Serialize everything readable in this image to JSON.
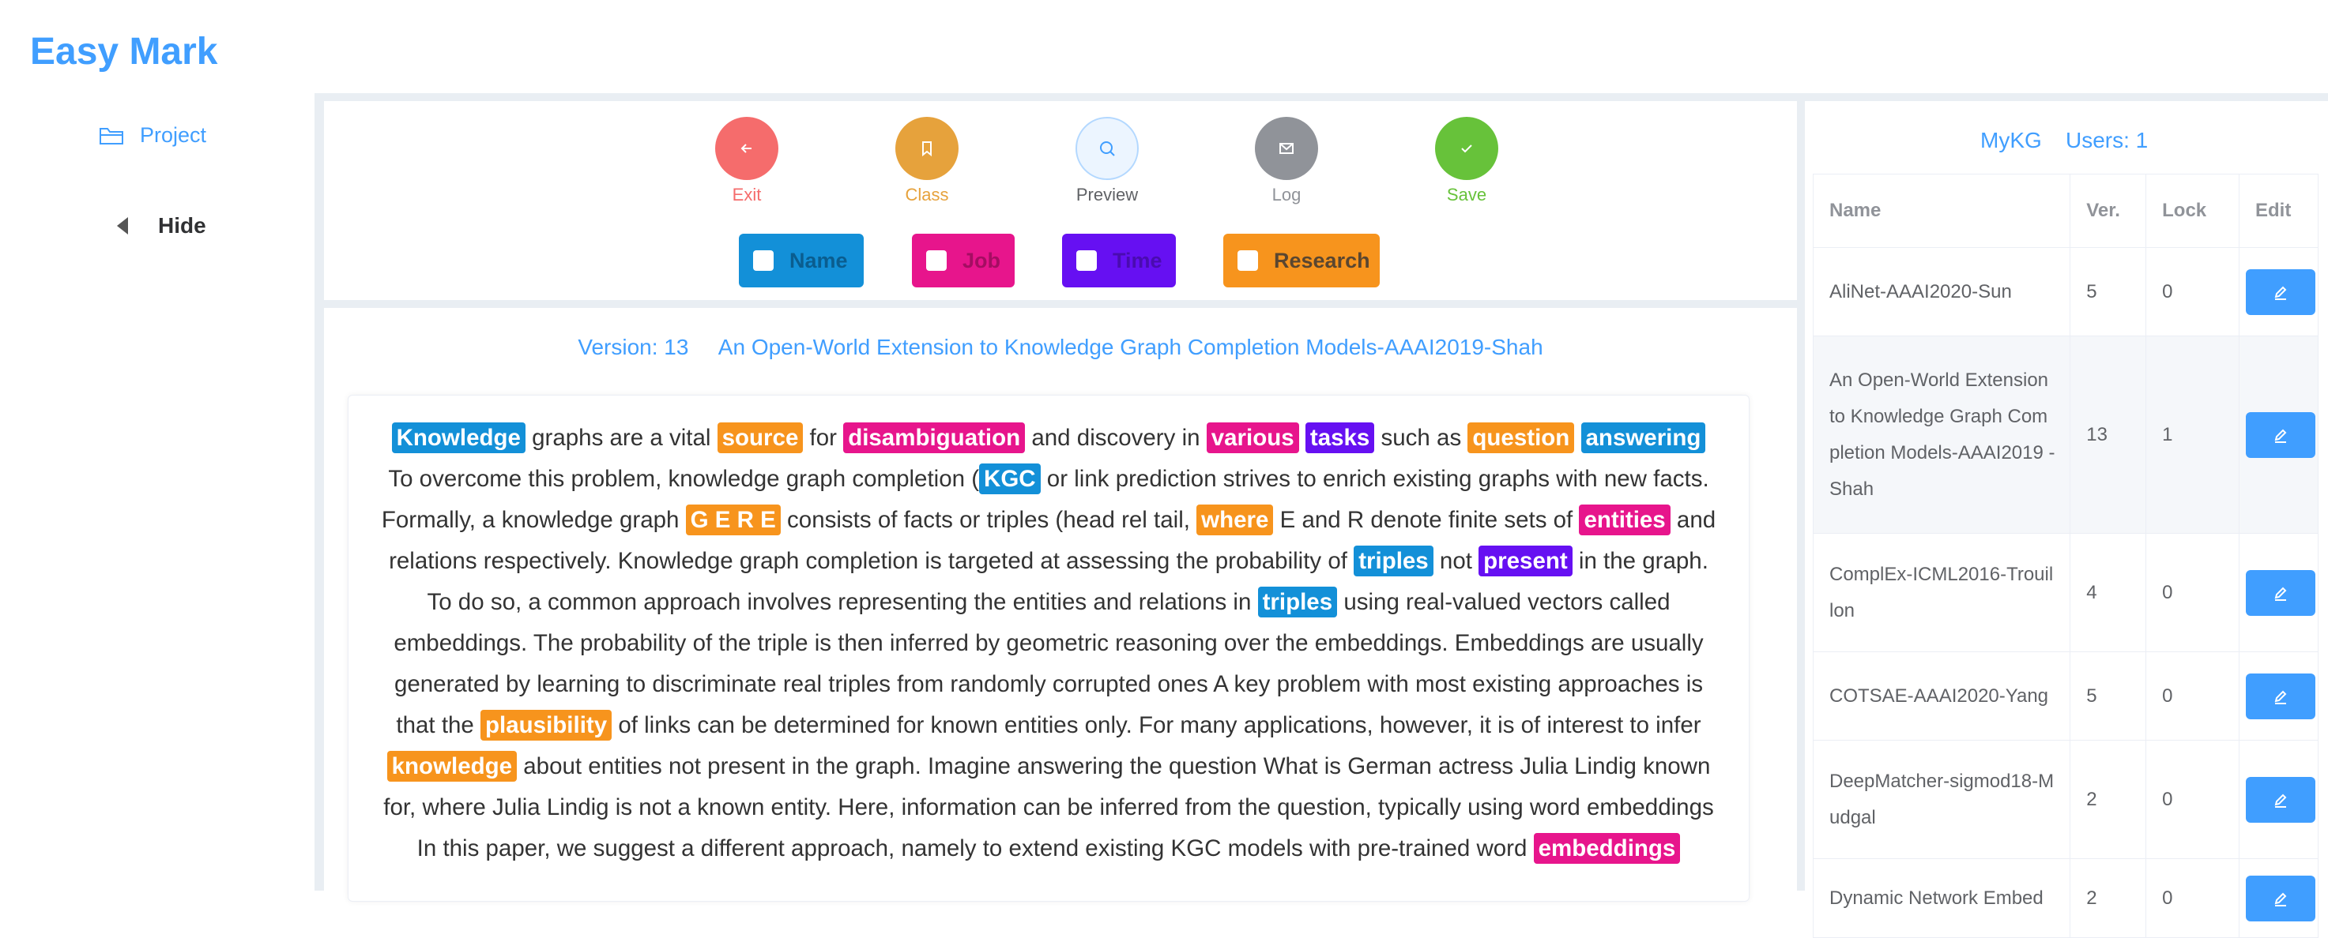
{
  "app": {
    "title": "Easy Mark"
  },
  "sidebar": {
    "project_label": "Project",
    "hide_label": "Hide"
  },
  "toolbar": {
    "exit": {
      "label": "Exit",
      "color": "#f56c6c",
      "icon": "arrow-left-icon"
    },
    "class": {
      "label": "Class",
      "color": "#e6a23c",
      "icon": "bookmark-icon"
    },
    "preview": {
      "label": "Preview",
      "color": "#ecf5ff",
      "icon": "search-icon"
    },
    "log": {
      "label": "Log",
      "color": "#909399",
      "icon": "envelope-icon"
    },
    "save": {
      "label": "Save",
      "color": "#67c23a",
      "icon": "check-icon"
    }
  },
  "tags": [
    {
      "label": "Name",
      "color": "#1390d8"
    },
    {
      "label": "Job",
      "color": "#e7158c"
    },
    {
      "label": "Time",
      "color": "#6610f2"
    },
    {
      "label": "Research",
      "color": "#f7941d"
    }
  ],
  "document": {
    "version": "Version: 13",
    "title": "An Open-World Extension to Knowledge Graph Completion Models-AAAI2019-Shah",
    "segments": [
      [
        "Knowledge",
        "b"
      ],
      [
        " graphs are a vital ",
        ""
      ],
      [
        "source",
        "o"
      ],
      [
        " for ",
        ""
      ],
      [
        "disambiguation",
        "p"
      ],
      [
        " and discovery in ",
        ""
      ],
      [
        "various",
        "p"
      ],
      [
        " ",
        ""
      ],
      [
        "tasks",
        "v"
      ],
      [
        " such as ",
        ""
      ],
      [
        "question",
        "o"
      ],
      [
        " ",
        ""
      ],
      [
        "answering",
        "b"
      ],
      [
        " To overcome this problem, knowledge graph completion (",
        ""
      ],
      [
        "KGC",
        "b"
      ],
      [
        " or link prediction strives to enrich existing graphs with new facts. Formally, a knowledge graph ",
        ""
      ],
      [
        "G E R E",
        "o"
      ],
      [
        " consists of facts or triples (head rel tail, ",
        ""
      ],
      [
        "where",
        "o"
      ],
      [
        " E and R denote finite sets of ",
        ""
      ],
      [
        "entities",
        "p"
      ],
      [
        " and relations respectively. Knowledge graph completion is targeted at assessing the probability of ",
        ""
      ],
      [
        "triples",
        "b"
      ],
      [
        " not ",
        ""
      ],
      [
        "present",
        "v"
      ],
      [
        " in the graph. To do so, a common approach involves representing the entities and relations in ",
        ""
      ],
      [
        "triples",
        "b"
      ],
      [
        " using real-valued vectors called embeddings. The probability of the triple is then inferred by geometric reasoning over the embeddings. Embeddings are usually generated by learning to discriminate real triples from randomly corrupted ones A key problem with most existing approaches is that the ",
        ""
      ],
      [
        "plausibility",
        "o"
      ],
      [
        " of links can be determined for known entities only. For many applications, however, it is of interest to infer ",
        ""
      ],
      [
        "knowledge",
        "o"
      ],
      [
        " about entities not present in the graph. Imagine answering the question What is German actress Julia Lindig known for, where Julia Lindig is not a known entity. Here, information can be inferred from the question, typically using word embeddings In this paper, we suggest a different approach, namely to extend existing KGC models with pre-trained word ",
        ""
      ],
      [
        "embeddings",
        "p"
      ]
    ]
  },
  "kg": {
    "name": "MyKG",
    "users": "Users: 1",
    "columns": [
      "Name",
      "Ver.",
      "Lock",
      "Edit"
    ],
    "rows": [
      {
        "name": "AliNet-AAAI2020-Sun",
        "ver": "5",
        "lock": "0"
      },
      {
        "name": "An Open-World Extension to Knowledge Graph Com pletion Models-AAAI2019 -Shah",
        "ver": "13",
        "lock": "1"
      },
      {
        "name": "ComplEx-ICML2016-Trouil lon",
        "ver": "4",
        "lock": "0"
      },
      {
        "name": "COTSAE-AAAI2020-Yang",
        "ver": "5",
        "lock": "0"
      },
      {
        "name": "DeepMatcher-sigmod18-Mudgal",
        "ver": "2",
        "lock": "0"
      },
      {
        "name": "Dynamic Network Embed",
        "ver": "2",
        "lock": "0"
      }
    ]
  }
}
